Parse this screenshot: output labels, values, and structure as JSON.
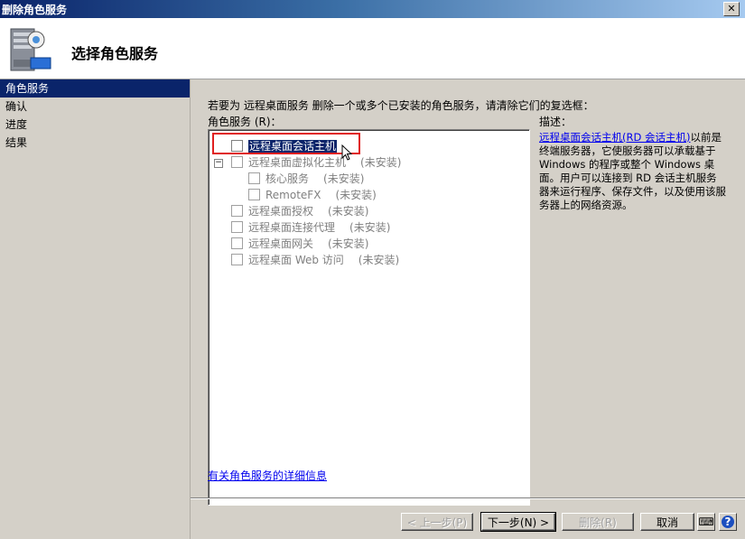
{
  "window": {
    "title": "删除角色服务",
    "close_glyph": "✕"
  },
  "header": {
    "title": "选择角色服务",
    "icon": "server-icon"
  },
  "nav": {
    "items": [
      {
        "label": "角色服务",
        "active": true
      },
      {
        "label": "确认",
        "active": false
      },
      {
        "label": "进度",
        "active": false
      },
      {
        "label": "结果",
        "active": false
      }
    ]
  },
  "main": {
    "instructions": "若要为 远程桌面服务 删除一个或多个已安装的角色服务，请清除它们的复选框：",
    "role_services_label": "角色服务 (R)：",
    "description_label": "描述：",
    "tree": [
      {
        "label": "远程桌面会话主机",
        "status": ""
      },
      {
        "label": "远程桌面虚拟化主机",
        "status": "(未安装)"
      },
      {
        "label": "核心服务",
        "status": "(未安装)"
      },
      {
        "label": "RemoteFX",
        "status": "(未安装)"
      },
      {
        "label": "远程桌面授权",
        "status": "(未安装)"
      },
      {
        "label": "远程桌面连接代理",
        "status": "(未安装)"
      },
      {
        "label": "远程桌面网关",
        "status": "(未安装)"
      },
      {
        "label": "远程桌面 Web 访问",
        "status": "(未安装)"
      }
    ],
    "description": {
      "link": "远程桌面会话主机(RD 会话主机)",
      "text": "以前是终端服务器，它使服务器可以承载基于 Windows 的程序或整个 Windows 桌面。用户可以连接到 RD 会话主机服务器来运行程序、保存文件，以及使用该服务器上的网络资源。"
    },
    "more_info_link": "有关角色服务的详细信息"
  },
  "buttons": {
    "previous": "< 上一步(P)",
    "next": "下一步(N) >",
    "remove": "删除(R)",
    "cancel": "取消"
  },
  "tray": {
    "keyboard": "⌨",
    "help": "?"
  },
  "colors": {
    "selection": "#0a246a",
    "highlight_box": "#e02020",
    "link": "#0000ee"
  }
}
